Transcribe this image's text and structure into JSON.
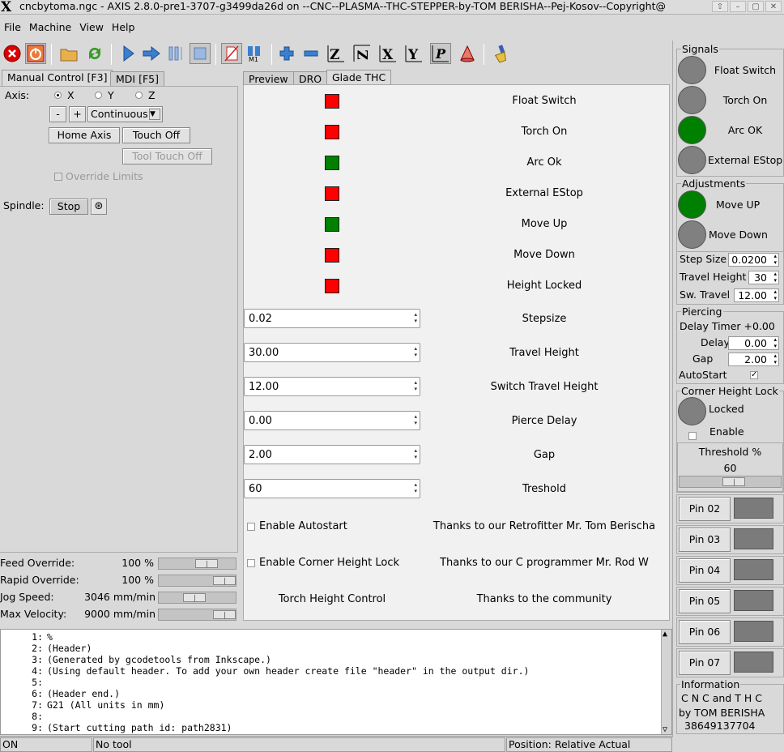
{
  "window": {
    "title": "cncbytoma.ngc - AXIS 2.8.0-pre1-3707-g3499da26d on --CNC--PLASMA--THC-STEPPER-by-TOM BERISHA--Pej-Kosov--Copyright@"
  },
  "menu": {
    "file": "File",
    "machine": "Machine",
    "view": "View",
    "help": "Help"
  },
  "left_tabs": {
    "manual": "Manual Control [F3]",
    "mdi": "MDI [F5]"
  },
  "manual": {
    "axis_label": "Axis:",
    "axis_x": "X",
    "axis_y": "Y",
    "axis_z": "Z",
    "minus": "-",
    "plus": "+",
    "jog_mode": "Continuous",
    "home_axis": "Home Axis",
    "touch_off": "Touch Off",
    "tool_touch_off": "Tool Touch Off",
    "override_limits": "Override Limits",
    "spindle_label": "Spindle:",
    "spindle_stop": "Stop"
  },
  "overrides": {
    "feed_label": "Feed Override:",
    "feed_value": "100 %",
    "rapid_label": "Rapid Override:",
    "rapid_value": "100 %",
    "jog_label": "Jog Speed:",
    "jog_value": "3046 mm/min",
    "maxvel_label": "Max Velocity:",
    "maxvel_value": "9000 mm/min"
  },
  "center_tabs": {
    "preview": "Preview",
    "dro": "DRO",
    "glade": "Glade THC"
  },
  "glade": {
    "leds": [
      {
        "label": "Float Switch",
        "color": "#ff0000"
      },
      {
        "label": "Torch On",
        "color": "#ff0000"
      },
      {
        "label": "Arc Ok",
        "color": "#008000"
      },
      {
        "label": "External EStop",
        "color": "#ff0000"
      },
      {
        "label": "Move Up",
        "color": "#008000"
      },
      {
        "label": "Move Down",
        "color": "#ff0000"
      },
      {
        "label": "Height Locked",
        "color": "#ff0000"
      }
    ],
    "spins": [
      {
        "value": "0.02",
        "label": "Stepsize"
      },
      {
        "value": "30.00",
        "label": "Travel Height"
      },
      {
        "value": "12.00",
        "label": "Switch Travel Height"
      },
      {
        "value": "0.00",
        "label": "Pierce Delay"
      },
      {
        "value": "2.00",
        "label": "Gap"
      },
      {
        "value": "60",
        "label": "Treshold"
      }
    ],
    "enable_autostart": "Enable Autostart",
    "enable_corner": "Enable Corner Height Lock",
    "thc_title": "Torch Height Control",
    "thanks1": "Thanks to our Retrofitter Mr. Tom Berischa",
    "thanks2": "Thanks to our C programmer Mr. Rod W",
    "thanks3": "Thanks to the community"
  },
  "right": {
    "signals_title": "Signals",
    "signals": [
      {
        "label": "Float Switch",
        "color": "#808080"
      },
      {
        "label": "Torch On",
        "color": "#808080"
      },
      {
        "label": "Arc OK",
        "color": "#008000"
      },
      {
        "label": "External EStop",
        "color": "#808080"
      }
    ],
    "adjustments_title": "Adjustments",
    "move_up": "Move UP",
    "move_up_color": "#008000",
    "move_down": "Move Down",
    "move_down_color": "#808080",
    "step_size_label": "Step Size",
    "step_size": "0.0200",
    "travel_height_label": "Travel Height",
    "travel_height": "30",
    "sw_travel_label": "Sw. Travel",
    "sw_travel": "12.00",
    "piercing_title": "Piercing",
    "delay_timer": "Delay Timer +0.00",
    "delay_label": "Delay",
    "delay": "0.00",
    "gap_label": "Gap",
    "gap": "2.00",
    "autostart_label": "AutoStart",
    "corner_title": "Corner Height Lock",
    "locked_label": "Locked",
    "enable_label": "Enable",
    "threshold_title": "Threshold %",
    "threshold_value": "60",
    "pins": [
      "Pin 02",
      "Pin 03",
      "Pin 04",
      "Pin 05",
      "Pin 06",
      "Pin 07"
    ],
    "info_title": "Information",
    "info_line1": "C N C and T H C",
    "info_line2": "by TOM BERISHA",
    "info_line3": "38649137704"
  },
  "gcode": [
    {
      "n": "1:",
      "text": "%"
    },
    {
      "n": "2:",
      "text": "(Header)"
    },
    {
      "n": "3:",
      "text": "(Generated by gcodetools from Inkscape.)"
    },
    {
      "n": "4:",
      "text": "(Using default header. To add your own header create file \"header\" in the output dir.)"
    },
    {
      "n": "5:",
      "text": ""
    },
    {
      "n": "6:",
      "text": "(Header end.)"
    },
    {
      "n": "7:",
      "text": "G21 (All units in mm)"
    },
    {
      "n": "8:",
      "text": ""
    },
    {
      "n": "9:",
      "text": "(Start cutting path id: path2831)"
    }
  ],
  "status": {
    "state": "ON",
    "tool": "No tool",
    "position": "Position: Relative Actual"
  }
}
